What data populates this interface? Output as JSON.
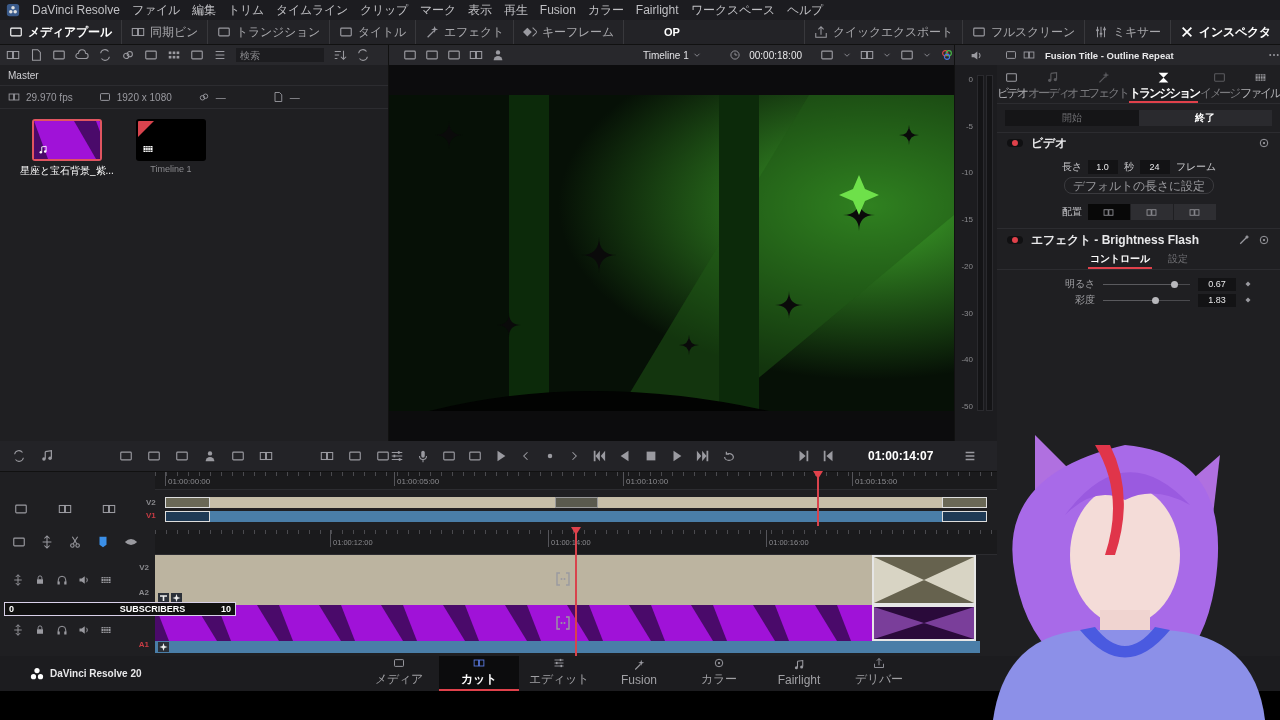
{
  "menu_bar": {
    "app": "DaVinci Resolve",
    "items": [
      "ファイル",
      "編集",
      "トリム",
      "タイムライン",
      "クリップ",
      "マーク",
      "表示",
      "再生",
      "Fusion",
      "カラー",
      "Fairlight",
      "ワークスペース",
      "ヘルプ"
    ]
  },
  "toolbar": {
    "left": [
      {
        "label": "メディアプール",
        "selected": true
      },
      {
        "label": "同期ビン",
        "selected": false
      },
      {
        "label": "トランジション",
        "selected": false
      },
      {
        "label": "タイトル",
        "selected": false
      },
      {
        "label": "エフェクト",
        "selected": false
      },
      {
        "label": "キーフレーム",
        "selected": false
      }
    ],
    "project": "OP",
    "right": [
      {
        "label": "クイックエクスポート",
        "selected": false
      },
      {
        "label": "フルスクリーン",
        "selected": false
      },
      {
        "label": "ミキサー",
        "selected": false
      },
      {
        "label": "インスペクタ",
        "selected": true
      }
    ]
  },
  "media_pool": {
    "search": {
      "placeholder": "検索"
    },
    "bin": "Master",
    "fps": "29.970 fps",
    "resolution": "1920 x 1080",
    "column_3": "—",
    "column_4": "—",
    "clips": [
      {
        "name": "星座と宝石背景_紫...",
        "kind": "audio",
        "selected": true,
        "flagged": false
      },
      {
        "name": "Timeline 1",
        "kind": "timeline",
        "selected": false,
        "flagged": true
      }
    ]
  },
  "viewer": {
    "timeline": "Timeline 1",
    "timecode": "00:00:18:00"
  },
  "audio_meter": {
    "scale": [
      "0",
      "-5",
      "-10",
      "-15",
      "-20",
      "-30",
      "-40",
      "-50"
    ]
  },
  "inspector": {
    "title": "Fusion Title - Outline Repeat",
    "tabs": [
      {
        "label": "ビデオ",
        "selected": false,
        "disabled": false
      },
      {
        "label": "オーディオ",
        "selected": false,
        "disabled": true
      },
      {
        "label": "エフェクト",
        "selected": false,
        "disabled": true
      },
      {
        "label": "トランジション",
        "selected": true,
        "disabled": false
      },
      {
        "label": "イメージ",
        "selected": false,
        "disabled": true
      },
      {
        "label": "ファイル",
        "selected": false,
        "disabled": false
      }
    ],
    "segments": [
      {
        "label": "開始",
        "selected": false
      },
      {
        "label": "終了",
        "selected": true
      }
    ],
    "video": {
      "title": "ビデオ",
      "on": true,
      "length_label": "長さ",
      "seconds": "1.0",
      "seconds_unit": "秒",
      "frames": "24",
      "frames_unit": "フレーム",
      "default_button": "デフォルトの長さに設定",
      "alignment_label": "配置",
      "alignment": [
        {
          "selected": true
        },
        {
          "selected": false
        },
        {
          "selected": false
        }
      ]
    },
    "effect": {
      "title": "エフェクト - Brightness Flash",
      "on": true,
      "tabs": [
        {
          "label": "コントロール",
          "selected": true
        },
        {
          "label": "設定",
          "selected": false
        }
      ],
      "params": [
        {
          "label": "明るさ",
          "level": 0.82,
          "value": "0.67"
        },
        {
          "label": "彩度",
          "level": 0.6,
          "value": "1.83"
        }
      ]
    }
  },
  "transport": {
    "timecode": "01:00:14:07"
  },
  "upper_timeline": {
    "ruler": [
      "01:00:00:00",
      "01:00:05:00",
      "01:00:10:00",
      "01:00:15:00"
    ],
    "tracks": [
      {
        "label": "V2",
        "targeted": false
      },
      {
        "label": "V1",
        "targeted": true
      }
    ]
  },
  "lower_timeline": {
    "ruler": [
      "01:00:12:00",
      "01:00:14:00",
      "01:00:16:00"
    ],
    "tracks": [
      {
        "label": "V2",
        "targeted": false
      },
      {
        "label": "A2",
        "targeted": false
      },
      {
        "label": "A1",
        "targeted": true
      }
    ]
  },
  "subscriber_bar": {
    "min": "0",
    "label": "SUBSCRIBERS",
    "max": "10"
  },
  "pages": {
    "brand": "DaVinci Resolve 20",
    "items": [
      {
        "label": "メディア",
        "selected": false
      },
      {
        "label": "カット",
        "selected": true
      },
      {
        "label": "エディット",
        "selected": false
      },
      {
        "label": "Fusion",
        "selected": false
      },
      {
        "label": "カラー",
        "selected": false
      },
      {
        "label": "Fairlight",
        "selected": false
      },
      {
        "label": "デリバー",
        "selected": false
      }
    ]
  }
}
